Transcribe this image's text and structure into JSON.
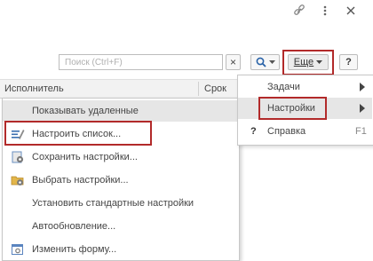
{
  "toolbar": {
    "search_placeholder": "Поиск (Ctrl+F)",
    "clear_glyph": "×",
    "more_label": "Еще",
    "help_label": "?"
  },
  "table": {
    "col_executor": "Исполнитель",
    "col_deadline": "Срок"
  },
  "menu": {
    "items": [
      {
        "label": "Показывать удаленные"
      },
      {
        "label": "Настроить список..."
      },
      {
        "label": "Сохранить настройки..."
      },
      {
        "label": "Выбрать настройки..."
      },
      {
        "label": "Установить стандартные настройки"
      },
      {
        "label": "Автообновление..."
      },
      {
        "label": "Изменить форму..."
      }
    ]
  },
  "submenu": {
    "items": [
      {
        "label": "Задачи"
      },
      {
        "label": "Настройки"
      },
      {
        "label": "Справка",
        "shortcut": "F1",
        "glyph": "?"
      }
    ]
  },
  "colors": {
    "highlight_border": "#b22a2a",
    "hover_bg": "#e6e6e6"
  }
}
